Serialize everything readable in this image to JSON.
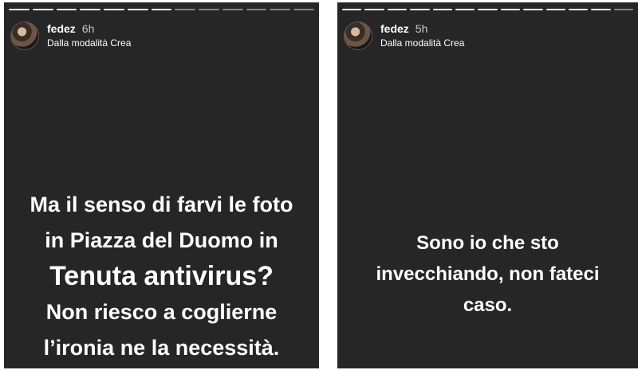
{
  "stories": [
    {
      "username": "fedez",
      "time": "6h",
      "mode": "Dalla modalità Crea",
      "text_lines": [
        "Ma il senso di farvi le foto",
        "in Piazza del Duomo in",
        "Tenuta antivirus?",
        "Non riesco a coglierne",
        "l’ironia ne la necessità."
      ]
    },
    {
      "username": "fedez",
      "time": "5h",
      "mode": "Dalla modalità Crea",
      "text_lines": [
        "Sono io che sto",
        "invecchiando, non fateci",
        "caso."
      ]
    }
  ]
}
